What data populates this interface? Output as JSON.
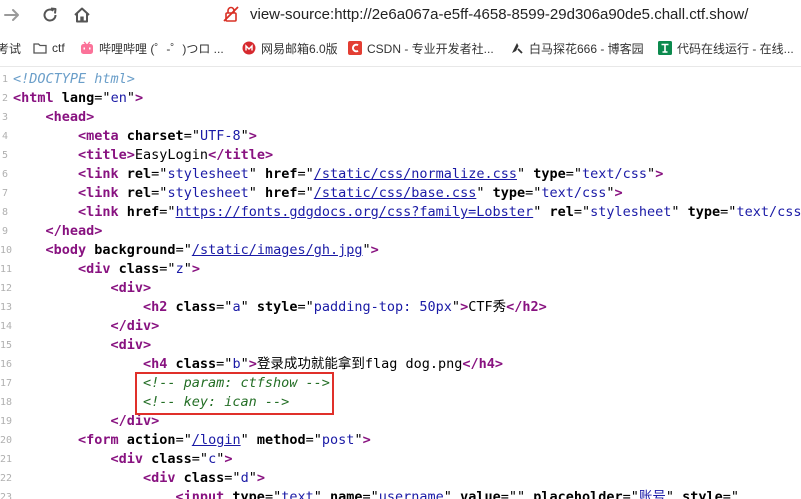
{
  "nav": {
    "url": "view-source:http://2e6a067a-e5ff-4658-8599-29d306a90de5.chall.ctf.show/"
  },
  "bookmarks": [
    {
      "label": "考试",
      "icon": "none"
    },
    {
      "label": "ctf",
      "icon": "folder-icon"
    },
    {
      "label": "哔哩哔哩 (゜-゜)つロ ...",
      "icon": "bilibili-icon"
    },
    {
      "label": "网易邮箱6.0版",
      "icon": "netease-mail-icon"
    },
    {
      "label": "CSDN - 专业开发者社...",
      "icon": "csdn-icon"
    },
    {
      "label": "白马探花666 - 博客园",
      "icon": "cnblogs-icon"
    },
    {
      "label": "代码在线运行 - 在线...",
      "icon": "code-runner-icon"
    }
  ],
  "source": {
    "highlighted_lines": [
      17,
      18
    ],
    "lines": [
      {
        "n": "1",
        "indent": 0,
        "parts": [
          {
            "c": "dt",
            "t": "<!DOCTYPE html>"
          }
        ]
      },
      {
        "n": "2",
        "indent": 0,
        "parts": [
          {
            "c": "tag",
            "t": "<html"
          },
          {
            "c": "tx",
            "t": " "
          },
          {
            "c": "an",
            "t": "lang"
          },
          {
            "c": "tx",
            "t": "=\""
          },
          {
            "c": "av",
            "t": "en"
          },
          {
            "c": "tx",
            "t": "\""
          },
          {
            "c": "tag",
            "t": ">"
          }
        ]
      },
      {
        "n": "3",
        "indent": 1,
        "parts": [
          {
            "c": "tag",
            "t": "<head>"
          }
        ]
      },
      {
        "n": "4",
        "indent": 2,
        "parts": [
          {
            "c": "tag",
            "t": "<meta"
          },
          {
            "c": "tx",
            "t": " "
          },
          {
            "c": "an",
            "t": "charset"
          },
          {
            "c": "tx",
            "t": "=\""
          },
          {
            "c": "av",
            "t": "UTF-8"
          },
          {
            "c": "tx",
            "t": "\""
          },
          {
            "c": "tag",
            "t": ">"
          }
        ]
      },
      {
        "n": "5",
        "indent": 2,
        "parts": [
          {
            "c": "tag",
            "t": "<title>"
          },
          {
            "c": "tx",
            "t": "EasyLogin"
          },
          {
            "c": "tag",
            "t": "</title>"
          }
        ]
      },
      {
        "n": "6",
        "indent": 2,
        "parts": [
          {
            "c": "tag",
            "t": "<link"
          },
          {
            "c": "tx",
            "t": " "
          },
          {
            "c": "an",
            "t": "rel"
          },
          {
            "c": "tx",
            "t": "=\""
          },
          {
            "c": "av",
            "t": "stylesheet"
          },
          {
            "c": "tx",
            "t": "\" "
          },
          {
            "c": "an",
            "t": "href"
          },
          {
            "c": "tx",
            "t": "=\""
          },
          {
            "c": "lnk",
            "t": "/static/css/normalize.css"
          },
          {
            "c": "tx",
            "t": "\" "
          },
          {
            "c": "an",
            "t": "type"
          },
          {
            "c": "tx",
            "t": "=\""
          },
          {
            "c": "av",
            "t": "text/css"
          },
          {
            "c": "tx",
            "t": "\""
          },
          {
            "c": "tag",
            "t": ">"
          }
        ]
      },
      {
        "n": "7",
        "indent": 2,
        "parts": [
          {
            "c": "tag",
            "t": "<link"
          },
          {
            "c": "tx",
            "t": " "
          },
          {
            "c": "an",
            "t": "rel"
          },
          {
            "c": "tx",
            "t": "=\""
          },
          {
            "c": "av",
            "t": "stylesheet"
          },
          {
            "c": "tx",
            "t": "\" "
          },
          {
            "c": "an",
            "t": "href"
          },
          {
            "c": "tx",
            "t": "=\""
          },
          {
            "c": "lnk",
            "t": "/static/css/base.css"
          },
          {
            "c": "tx",
            "t": "\" "
          },
          {
            "c": "an",
            "t": "type"
          },
          {
            "c": "tx",
            "t": "=\""
          },
          {
            "c": "av",
            "t": "text/css"
          },
          {
            "c": "tx",
            "t": "\""
          },
          {
            "c": "tag",
            "t": ">"
          }
        ]
      },
      {
        "n": "8",
        "indent": 2,
        "parts": [
          {
            "c": "tag",
            "t": "<link"
          },
          {
            "c": "tx",
            "t": " "
          },
          {
            "c": "an",
            "t": "href"
          },
          {
            "c": "tx",
            "t": "=\""
          },
          {
            "c": "lnk",
            "t": "https://fonts.gdgdocs.org/css?family=Lobster"
          },
          {
            "c": "tx",
            "t": "\" "
          },
          {
            "c": "an",
            "t": "rel"
          },
          {
            "c": "tx",
            "t": "=\""
          },
          {
            "c": "av",
            "t": "stylesheet"
          },
          {
            "c": "tx",
            "t": "\" "
          },
          {
            "c": "an",
            "t": "type"
          },
          {
            "c": "tx",
            "t": "=\""
          },
          {
            "c": "av",
            "t": "text/css"
          }
        ]
      },
      {
        "n": "9",
        "indent": 1,
        "parts": [
          {
            "c": "tag",
            "t": "</head>"
          }
        ]
      },
      {
        "n": "10",
        "indent": 1,
        "parts": [
          {
            "c": "tag",
            "t": "<body"
          },
          {
            "c": "tx",
            "t": " "
          },
          {
            "c": "an",
            "t": "background"
          },
          {
            "c": "tx",
            "t": "=\""
          },
          {
            "c": "lnk",
            "t": "/static/images/gh.jpg"
          },
          {
            "c": "tx",
            "t": "\""
          },
          {
            "c": "tag",
            "t": ">"
          }
        ]
      },
      {
        "n": "11",
        "indent": 2,
        "parts": [
          {
            "c": "tag",
            "t": "<div"
          },
          {
            "c": "tx",
            "t": " "
          },
          {
            "c": "an",
            "t": "class"
          },
          {
            "c": "tx",
            "t": "=\""
          },
          {
            "c": "av",
            "t": "z"
          },
          {
            "c": "tx",
            "t": "\""
          },
          {
            "c": "tag",
            "t": ">"
          }
        ]
      },
      {
        "n": "12",
        "indent": 3,
        "parts": [
          {
            "c": "tag",
            "t": "<div>"
          }
        ]
      },
      {
        "n": "13",
        "indent": 4,
        "parts": [
          {
            "c": "tag",
            "t": "<h2"
          },
          {
            "c": "tx",
            "t": " "
          },
          {
            "c": "an",
            "t": "class"
          },
          {
            "c": "tx",
            "t": "=\""
          },
          {
            "c": "av",
            "t": "a"
          },
          {
            "c": "tx",
            "t": "\" "
          },
          {
            "c": "an",
            "t": "style"
          },
          {
            "c": "tx",
            "t": "=\""
          },
          {
            "c": "av",
            "t": "padding-top: 50px"
          },
          {
            "c": "tx",
            "t": "\""
          },
          {
            "c": "tag",
            "t": ">"
          },
          {
            "c": "tx",
            "t": "CTF秀"
          },
          {
            "c": "tag",
            "t": "</h2>"
          }
        ]
      },
      {
        "n": "14",
        "indent": 3,
        "parts": [
          {
            "c": "tag",
            "t": "</div>"
          }
        ]
      },
      {
        "n": "15",
        "indent": 3,
        "parts": [
          {
            "c": "tag",
            "t": "<div>"
          }
        ]
      },
      {
        "n": "16",
        "indent": 4,
        "parts": [
          {
            "c": "tag",
            "t": "<h4"
          },
          {
            "c": "tx",
            "t": " "
          },
          {
            "c": "an",
            "t": "class"
          },
          {
            "c": "tx",
            "t": "=\""
          },
          {
            "c": "av",
            "t": "b"
          },
          {
            "c": "tx",
            "t": "\""
          },
          {
            "c": "tag",
            "t": ">"
          },
          {
            "c": "tx",
            "t": "登录成功就能拿到flag dog.png"
          },
          {
            "c": "tag",
            "t": "</h4>"
          }
        ]
      },
      {
        "n": "17",
        "indent": 4,
        "parts": [
          {
            "c": "cm",
            "t": "<!-- param: ctfshow -->"
          }
        ]
      },
      {
        "n": "18",
        "indent": 4,
        "parts": [
          {
            "c": "cm",
            "t": "<!-- key: ican -->"
          }
        ]
      },
      {
        "n": "19",
        "indent": 3,
        "parts": [
          {
            "c": "tag",
            "t": "</div>"
          }
        ]
      },
      {
        "n": "20",
        "indent": 2,
        "parts": [
          {
            "c": "tag",
            "t": "<form"
          },
          {
            "c": "tx",
            "t": " "
          },
          {
            "c": "an",
            "t": "action"
          },
          {
            "c": "tx",
            "t": "=\""
          },
          {
            "c": "lnk",
            "t": "/login"
          },
          {
            "c": "tx",
            "t": "\" "
          },
          {
            "c": "an",
            "t": "method"
          },
          {
            "c": "tx",
            "t": "=\""
          },
          {
            "c": "av",
            "t": "post"
          },
          {
            "c": "tx",
            "t": "\""
          },
          {
            "c": "tag",
            "t": ">"
          }
        ]
      },
      {
        "n": "21",
        "indent": 3,
        "parts": [
          {
            "c": "tag",
            "t": "<div"
          },
          {
            "c": "tx",
            "t": " "
          },
          {
            "c": "an",
            "t": "class"
          },
          {
            "c": "tx",
            "t": "=\""
          },
          {
            "c": "av",
            "t": "c"
          },
          {
            "c": "tx",
            "t": "\""
          },
          {
            "c": "tag",
            "t": ">"
          }
        ]
      },
      {
        "n": "22",
        "indent": 4,
        "parts": [
          {
            "c": "tag",
            "t": "<div"
          },
          {
            "c": "tx",
            "t": " "
          },
          {
            "c": "an",
            "t": "class"
          },
          {
            "c": "tx",
            "t": "=\""
          },
          {
            "c": "av",
            "t": "d"
          },
          {
            "c": "tx",
            "t": "\""
          },
          {
            "c": "tag",
            "t": ">"
          }
        ]
      },
      {
        "n": "23",
        "indent": 5,
        "parts": [
          {
            "c": "tag",
            "t": "<input"
          },
          {
            "c": "tx",
            "t": " "
          },
          {
            "c": "an",
            "t": "type"
          },
          {
            "c": "tx",
            "t": "=\""
          },
          {
            "c": "av",
            "t": "text"
          },
          {
            "c": "tx",
            "t": "\" "
          },
          {
            "c": "an",
            "t": "name"
          },
          {
            "c": "tx",
            "t": "=\""
          },
          {
            "c": "av",
            "t": "username"
          },
          {
            "c": "tx",
            "t": "\" "
          },
          {
            "c": "an",
            "t": "value"
          },
          {
            "c": "tx",
            "t": "=\"\" "
          },
          {
            "c": "an",
            "t": "placeholder"
          },
          {
            "c": "tx",
            "t": "=\""
          },
          {
            "c": "av",
            "t": "账号"
          },
          {
            "c": "tx",
            "t": "\" "
          },
          {
            "c": "an",
            "t": "style"
          },
          {
            "c": "tx",
            "t": "=\""
          }
        ]
      }
    ]
  }
}
